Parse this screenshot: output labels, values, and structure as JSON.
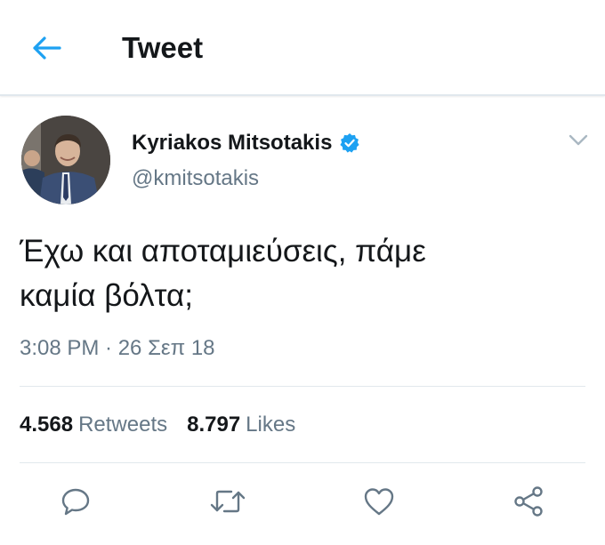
{
  "header": {
    "title": "Tweet",
    "back_icon": "arrow-left-icon"
  },
  "tweet": {
    "author": {
      "display_name": "Kyriakos Mitsotakis",
      "handle": "@kmitsotakis",
      "verified": true
    },
    "text": "Έχω και αποταμιεύσεις, πάμε\nκαμία βόλτα;",
    "timestamp": "3:08 PM · 26 Σεπ 18",
    "stats": {
      "retweets_count": "4.568",
      "retweets_label": "Retweets",
      "likes_count": "8.797",
      "likes_label": "Likes"
    },
    "actions": [
      "reply-icon",
      "retweet-icon",
      "like-icon",
      "share-icon"
    ]
  },
  "colors": {
    "accent": "#1da1f2",
    "text_primary": "#14171a",
    "text_secondary": "#657786",
    "divider": "#e1e8ed"
  }
}
